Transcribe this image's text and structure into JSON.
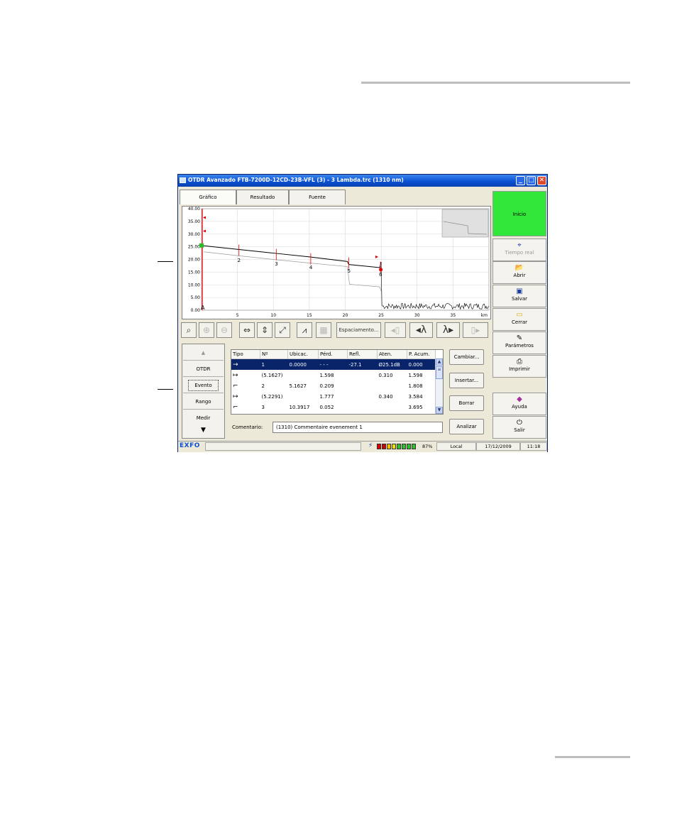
{
  "window": {
    "title": "OTDR Avanzado FTB-7200D-12CD-23B-VFL (3) - 3 Lambda.trc (1310 nm)"
  },
  "tabs": [
    {
      "label": "Gráfico"
    },
    {
      "label": "Resultado"
    },
    {
      "label": "Fuente"
    }
  ],
  "graph": {
    "y_ticks": [
      "40.00",
      "35.00",
      "30.00",
      "25.00",
      "20.00",
      "15.00",
      "10.00",
      "5.00",
      "0.00"
    ],
    "x_ticks": [
      "5",
      "10",
      "15",
      "20",
      "25",
      "30",
      "35"
    ],
    "x_unit": "km",
    "markers": [
      "A"
    ],
    "event_labels": [
      "2",
      "3",
      "4",
      "5",
      "6"
    ]
  },
  "chart_data": {
    "type": "line",
    "title": "",
    "xlabel": "km",
    "ylabel": "",
    "xlim": [
      0,
      40
    ],
    "ylim": [
      0,
      40
    ],
    "grid": true,
    "series": [
      {
        "x": [
          0,
          5,
          10,
          15,
          20.3,
          20.5,
          24.8,
          25.0,
          25.2,
          40
        ],
        "y": [
          25.5,
          24.0,
          22.5,
          21.0,
          19.2,
          18.0,
          16.8,
          19.0,
          1.5,
          0.8
        ]
      },
      {
        "x": [
          0.3,
          5,
          10,
          15,
          20.3,
          20.6,
          24.8,
          25.0
        ],
        "y": [
          23.0,
          21.5,
          20.0,
          18.6,
          17.2,
          10.2,
          9.2,
          7.5
        ]
      }
    ],
    "events": [
      {
        "label": "2",
        "km": 5.2
      },
      {
        "label": "3",
        "km": 10.4
      },
      {
        "label": "4",
        "km": 15.2
      },
      {
        "label": "5",
        "km": 20.5
      },
      {
        "label": "6",
        "km": 24.9
      }
    ]
  },
  "toolbar": {
    "spacing_label": "Espaciamento..."
  },
  "nav": {
    "items": [
      "OTDR",
      "Evento",
      "Rango",
      "Medir"
    ],
    "selected": "Evento"
  },
  "table": {
    "columns": [
      "Tipo",
      "Nº",
      "Ubicac.",
      "Pérd.",
      "Refl.",
      "Aten.",
      "P. Acum."
    ],
    "rows": [
      {
        "type": "→",
        "no": "1",
        "loc": "0.0000",
        "loss": "- - -",
        "refl": "-27.1",
        "atten": "Ø25.1dB",
        "cum": "0.000"
      },
      {
        "type": "↦",
        "no": "(5.1627)",
        "loc": "",
        "loss": "1.598",
        "refl": "",
        "atten": "0.310",
        "cum": "1.598"
      },
      {
        "type": "⌐",
        "no": "2",
        "loc": "5.1627",
        "loss": "0.209",
        "refl": "",
        "atten": "",
        "cum": "1.808"
      },
      {
        "type": "↦",
        "no": "(5.2291)",
        "loc": "",
        "loss": "1.777",
        "refl": "",
        "atten": "0.340",
        "cum": "3.584"
      },
      {
        "type": "⌐",
        "no": "3",
        "loc": "10.3917",
        "loss": "0.052",
        "refl": "",
        "atten": "",
        "cum": "3.695"
      }
    ]
  },
  "comment": {
    "label": "Comentario:",
    "value": "(1310) Commentaire evenement 1"
  },
  "actions": {
    "change": "Cambiar...",
    "insert": "Insertar...",
    "delete": "Borrar",
    "analyze": "Analizar"
  },
  "side": {
    "start": "Inicio",
    "realtime": "Tiempo real",
    "open": "Abrir",
    "save": "Salvar",
    "close": "Cerrar",
    "params": "Parámetros",
    "print": "Imprimir",
    "help": "Ayuda",
    "exit": "Salir"
  },
  "status": {
    "logo": "EXFO",
    "battery": "87%",
    "mode": "Local",
    "date": "17/12/2009",
    "time": "11:18"
  },
  "colors": {
    "start_bg": "#33e63a",
    "titlebar": "#0a4fd0",
    "selection": "#0a246a",
    "marker": "#e00000"
  }
}
